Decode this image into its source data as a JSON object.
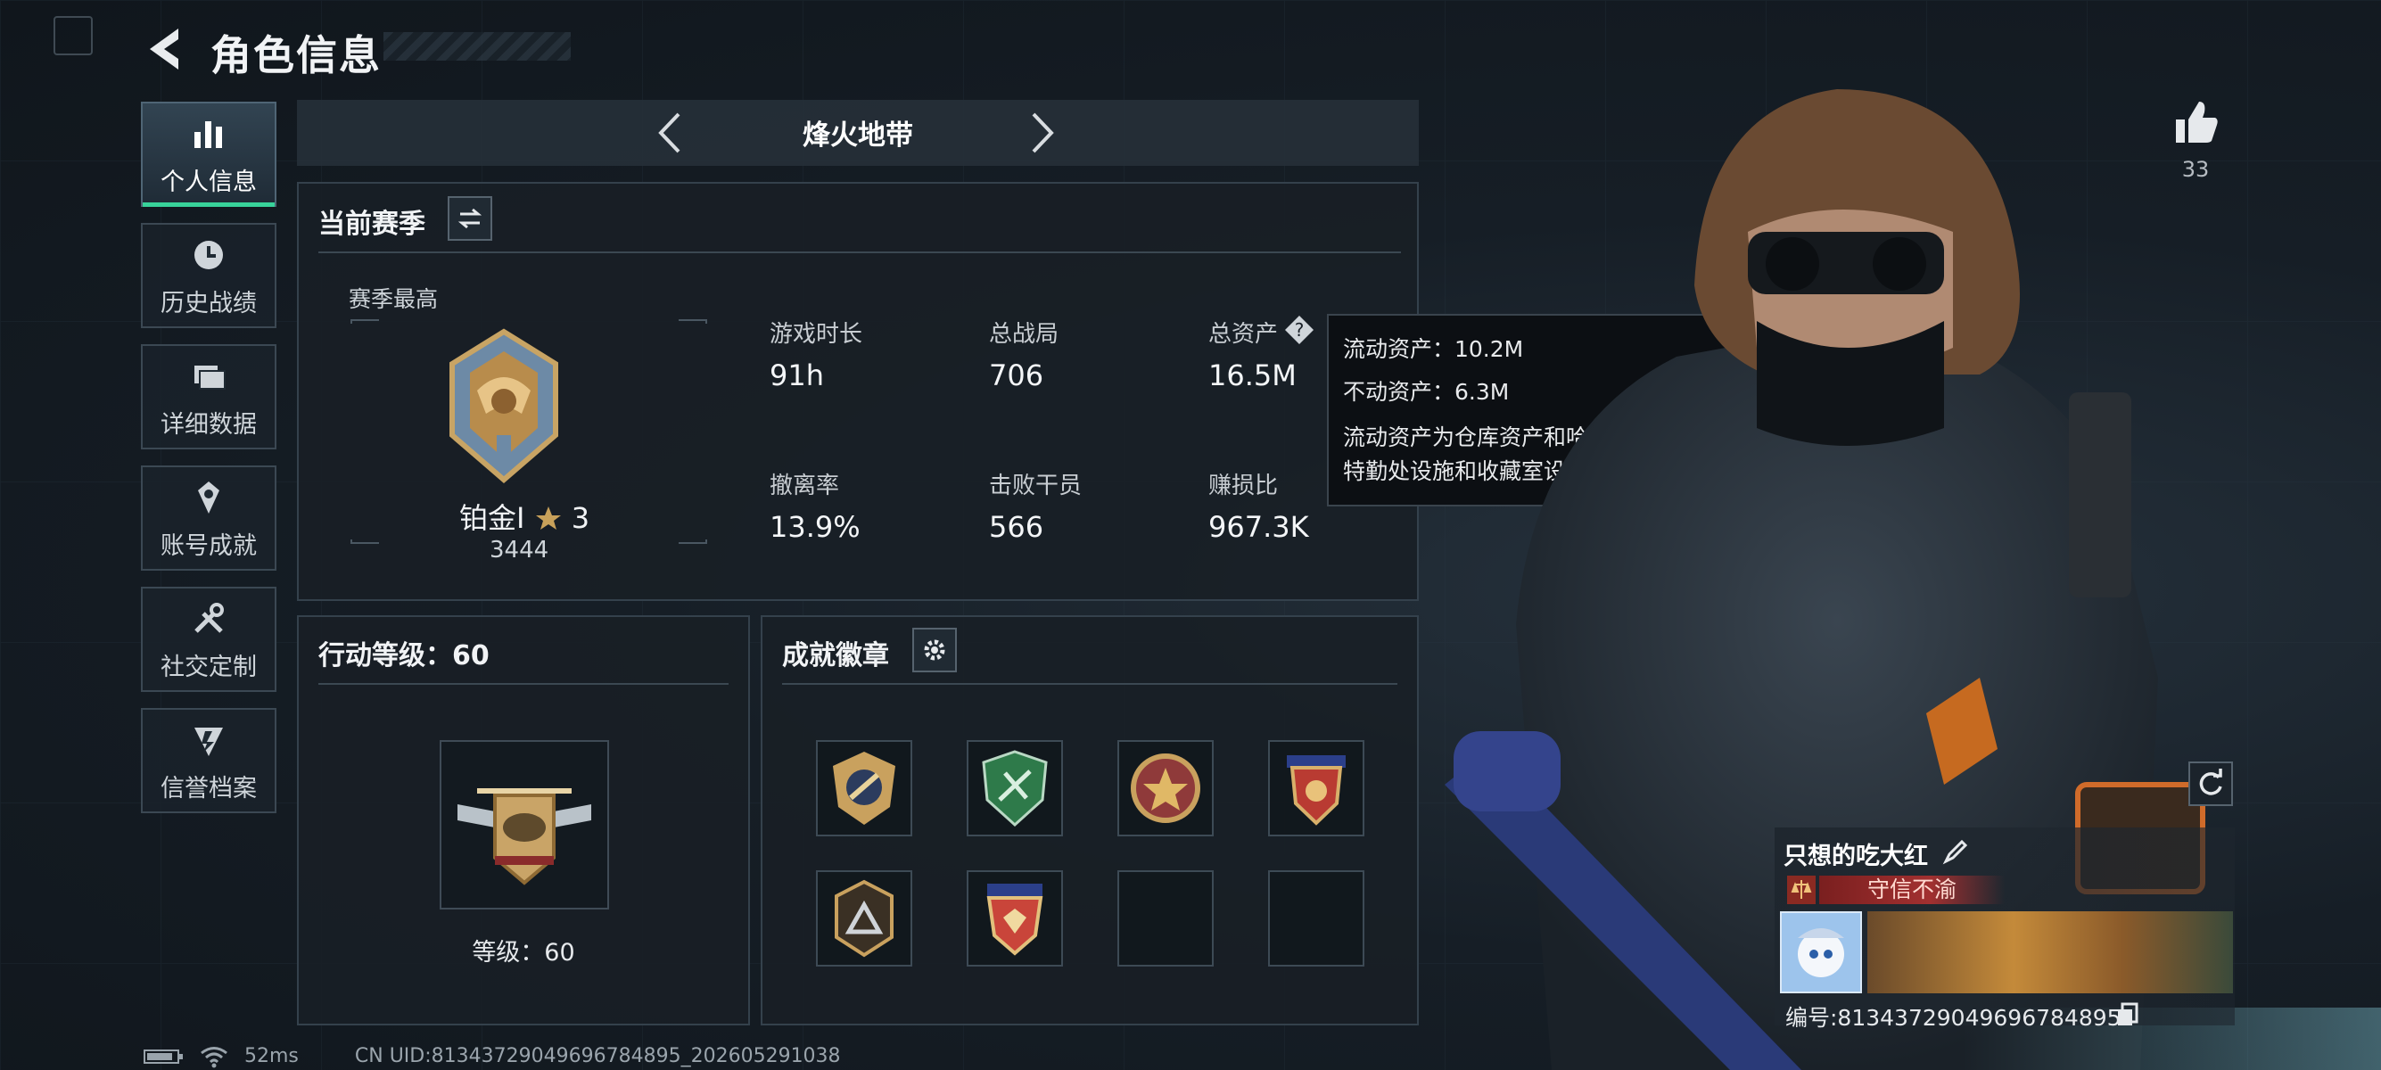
{
  "header": {
    "title": "角色信息"
  },
  "nav": [
    {
      "label": "个人信息",
      "icon": "bar-chart-icon",
      "active": true
    },
    {
      "label": "历史战绩",
      "icon": "clock-icon",
      "active": false
    },
    {
      "label": "详细数据",
      "icon": "folder-icon",
      "active": false
    },
    {
      "label": "账号成就",
      "icon": "medal-icon",
      "active": false
    },
    {
      "label": "社交定制",
      "icon": "tools-icon",
      "active": false
    },
    {
      "label": "信誉档案",
      "icon": "shield-icon",
      "active": false
    }
  ],
  "mode": {
    "name": "烽火地带"
  },
  "season": {
    "section_label": "当前赛季",
    "best_label": "赛季最高",
    "rank_name": "铂金Ⅰ",
    "rank_stars": "3",
    "rank_score": "3444"
  },
  "stats": [
    {
      "label": "游戏时长",
      "value": "91h"
    },
    {
      "label": "总战局",
      "value": "706"
    },
    {
      "label": "总资产",
      "value": "16.5M"
    },
    {
      "label": "撤离率",
      "value": "13.9%"
    },
    {
      "label": "击败干员",
      "value": "566"
    },
    {
      "label": "赚损比",
      "value": "967.3K"
    }
  ],
  "tooltip": {
    "liquid": "流动资产：10.2M",
    "fixed": "不动资产：6.3M",
    "desc": "流动资产为仓库资产和哈夫币，不动资产为特勤处设施和收藏室设施"
  },
  "action_level": {
    "label": "行动等级：60",
    "level_text": "等级：60"
  },
  "achievements": {
    "label": "成就徽章",
    "badges": [
      "badge-1",
      "badge-2",
      "badge-3",
      "badge-4",
      "badge-5",
      "badge-6",
      "empty",
      "empty"
    ]
  },
  "profile": {
    "likes": "33",
    "name": "只想的吃大红",
    "motto": "守信不渝",
    "id_text": "编号:8134372904969678489​5"
  },
  "status_bar": {
    "ping": "52ms",
    "uid": "CN UID:8134372904969678489​5_202605291038"
  }
}
